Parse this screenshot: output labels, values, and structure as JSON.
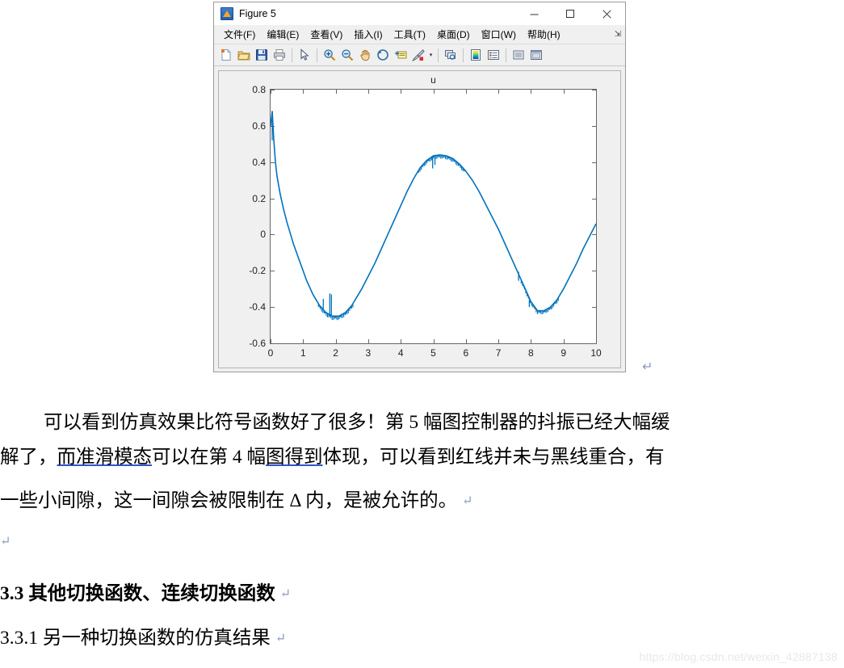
{
  "figure_window": {
    "title": "Figure 5",
    "title_icon": "matlab-logo-icon",
    "window_buttons": [
      {
        "name": "minimize",
        "glyph": "—"
      },
      {
        "name": "maximize",
        "glyph": "▢"
      },
      {
        "name": "close",
        "glyph": "✕"
      }
    ],
    "menu": [
      {
        "label": "文件(F)",
        "mnemonic": "F"
      },
      {
        "label": "编辑(E)",
        "mnemonic": "E"
      },
      {
        "label": "查看(V)",
        "mnemonic": "V"
      },
      {
        "label": "插入(I)",
        "mnemonic": "I"
      },
      {
        "label": "工具(T)",
        "mnemonic": "T"
      },
      {
        "label": "桌面(D)",
        "mnemonic": "D"
      },
      {
        "label": "窗口(W)",
        "mnemonic": "W"
      },
      {
        "label": "帮助(H)",
        "mnemonic": "H"
      }
    ],
    "menu_overflow_glyph": "⇲",
    "toolbar": [
      {
        "name": "new-figure-icon"
      },
      {
        "name": "open-file-icon"
      },
      {
        "name": "save-figure-icon"
      },
      {
        "name": "print-figure-icon"
      },
      {
        "name": "separator"
      },
      {
        "name": "edit-plot-pointer-icon"
      },
      {
        "name": "separator"
      },
      {
        "name": "zoom-in-icon"
      },
      {
        "name": "zoom-out-icon"
      },
      {
        "name": "pan-icon"
      },
      {
        "name": "rotate-3d-icon"
      },
      {
        "name": "data-cursor-icon"
      },
      {
        "name": "brush-data-icon"
      },
      {
        "name": "brush-dropdown-caret"
      },
      {
        "name": "separator"
      },
      {
        "name": "link-plot-icon"
      },
      {
        "name": "separator"
      },
      {
        "name": "insert-colorbar-icon"
      },
      {
        "name": "insert-legend-icon"
      },
      {
        "name": "separator"
      },
      {
        "name": "hide-plot-tools-icon"
      },
      {
        "name": "show-plot-tools-icon"
      }
    ]
  },
  "chart_data": {
    "type": "line",
    "title": "u",
    "xlabel": "",
    "ylabel": "",
    "xlim": [
      0,
      10
    ],
    "ylim": [
      -0.6,
      0.8
    ],
    "xticks": [
      0,
      1,
      2,
      3,
      4,
      5,
      6,
      7,
      8,
      9,
      10
    ],
    "yticks": [
      -0.6,
      -0.4,
      -0.2,
      0,
      0.2,
      0.4,
      0.6,
      0.8
    ],
    "grid": false,
    "legend": null,
    "line_color": "#0072BD",
    "series": [
      {
        "name": "u",
        "description": "控制量 u：起始有尖峰至 0.68，随后快速下降，在 x≈2.0 达到谷值 -0.45（伴随 x≈1.6~1.9 的抖振尖峰），在 x≈5.2 达到峰值 0.44（带小幅抖振），在 x≈8.2 达到第二个谷值 -0.42，末端 x=10 回升至约 0.06",
        "x": [
          0,
          0.05,
          0.1,
          0.15,
          0.2,
          0.3,
          0.4,
          0.5,
          0.6,
          0.7,
          0.8,
          0.9,
          1.0,
          1.1,
          1.2,
          1.3,
          1.4,
          1.5,
          1.6,
          1.7,
          1.8,
          1.9,
          2.0,
          2.1,
          2.2,
          2.3,
          2.4,
          2.5,
          2.6,
          2.8,
          3.0,
          3.2,
          3.4,
          3.6,
          3.8,
          4.0,
          4.2,
          4.4,
          4.6,
          4.8,
          5.0,
          5.2,
          5.4,
          5.6,
          5.8,
          6.0,
          6.2,
          6.4,
          6.6,
          6.8,
          7.0,
          7.2,
          7.4,
          7.6,
          7.8,
          8.0,
          8.2,
          8.4,
          8.6,
          8.8,
          9.0,
          9.2,
          9.4,
          9.6,
          9.8,
          10.0
        ],
        "y": [
          0.6,
          0.68,
          0.52,
          0.4,
          0.32,
          0.22,
          0.14,
          0.07,
          0.01,
          -0.05,
          -0.1,
          -0.15,
          -0.2,
          -0.25,
          -0.29,
          -0.33,
          -0.36,
          -0.39,
          -0.41,
          -0.43,
          -0.44,
          -0.45,
          -0.45,
          -0.45,
          -0.44,
          -0.43,
          -0.41,
          -0.39,
          -0.36,
          -0.3,
          -0.23,
          -0.16,
          -0.08,
          0.0,
          0.08,
          0.16,
          0.24,
          0.31,
          0.37,
          0.41,
          0.435,
          0.44,
          0.435,
          0.42,
          0.39,
          0.35,
          0.3,
          0.24,
          0.17,
          0.1,
          0.03,
          -0.05,
          -0.13,
          -0.21,
          -0.29,
          -0.37,
          -0.42,
          -0.42,
          -0.4,
          -0.36,
          -0.3,
          -0.23,
          -0.16,
          -0.08,
          -0.01,
          0.06
        ],
        "chatter_spikes": [
          {
            "x": 0.05,
            "y_high": 0.68,
            "y_low": 0.52
          },
          {
            "x": 1.62,
            "y_high": -0.355,
            "y_low": -0.41
          },
          {
            "x": 1.82,
            "y_high": -0.325,
            "y_low": -0.44
          },
          {
            "x": 1.87,
            "y_high": -0.33,
            "y_low": -0.445
          },
          {
            "x": 4.98,
            "y_high": 0.43,
            "y_low": 0.365
          },
          {
            "x": 5.05,
            "y_high": 0.44,
            "y_low": 0.385
          },
          {
            "x": 7.62,
            "y_high": -0.205,
            "y_low": -0.255
          },
          {
            "x": 7.95,
            "y_high": -0.36,
            "y_low": -0.4
          }
        ]
      }
    ]
  },
  "document": {
    "paragraph": [
      {
        "id": "p1-line1",
        "indent": true,
        "runs": [
          {
            "text": "可以看到仿真效果比符号函数好了很多！第 5 幅图控制器的抖振已经大幅缓",
            "style": "normal"
          }
        ]
      },
      {
        "id": "p1-line2",
        "indent": false,
        "runs": [
          {
            "text": "解了，",
            "style": "normal"
          },
          {
            "text": "而准滑模态",
            "style": "underline-blue"
          },
          {
            "text": "可以在第 4 幅",
            "style": "normal"
          },
          {
            "text": "图得到",
            "style": "underline-blue"
          },
          {
            "text": "体现，可以看到红线并未与黑线重合，有",
            "style": "normal"
          }
        ]
      },
      {
        "id": "p1-line3",
        "indent": false,
        "runs": [
          {
            "text": "一些小间隙，这一间隙会被限制在 Δ 内，是被允许的。",
            "style": "normal"
          },
          {
            "text": "↵",
            "style": "pilcrow"
          }
        ]
      }
    ],
    "empty_line_mark": "↵",
    "headings": [
      {
        "id": "h33",
        "number": "3.3",
        "text": " 其他切换函数、连续切换函数",
        "mark": "↵",
        "bold_number": true
      },
      {
        "id": "h331",
        "number": "3.3.1",
        "text": " 另一种切换函数的仿真结果",
        "mark": "↵",
        "bold_number": false
      }
    ],
    "figure_caption_mark": "↵",
    "watermark": "https://blog.csdn.net/weixin_42887138"
  }
}
